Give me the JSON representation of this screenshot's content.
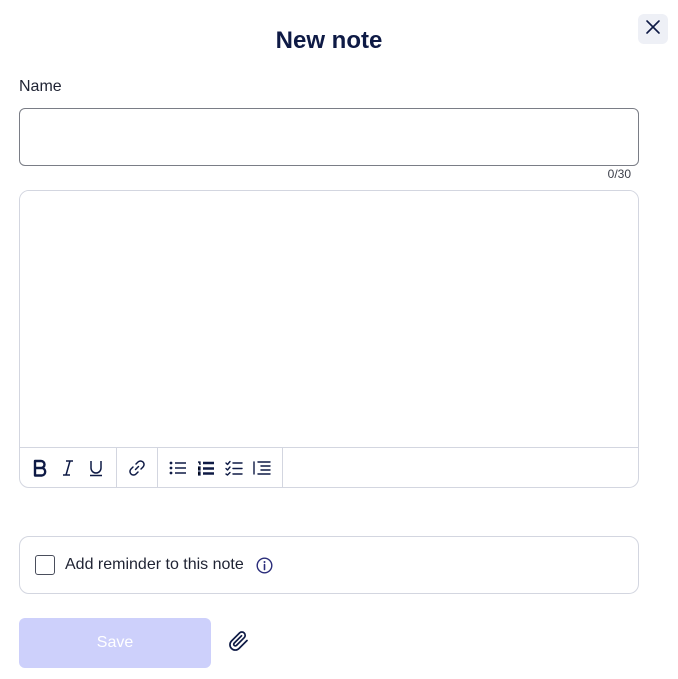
{
  "dialog": {
    "title": "New note",
    "close_icon": "close-icon"
  },
  "name_field": {
    "label": "Name",
    "value": "",
    "placeholder": "",
    "counter": "0/30"
  },
  "editor": {
    "value": "",
    "toolbar": {
      "format_group": [
        "bold-icon",
        "italic-icon",
        "underline-icon"
      ],
      "link_group": [
        "link-icon"
      ],
      "list_group": [
        "bullet-list-icon",
        "numbered-list-icon",
        "checklist-icon",
        "indent-icon"
      ]
    }
  },
  "reminder": {
    "checked": false,
    "label": "Add reminder to this note",
    "info_icon": "info-icon"
  },
  "actions": {
    "save_label": "Save",
    "attach_icon": "paperclip-icon"
  },
  "colors": {
    "title": "#0e1a45",
    "save_disabled_bg": "#cdd0fb",
    "border": "#d3d6e0",
    "close_bg": "#eef0f6"
  }
}
